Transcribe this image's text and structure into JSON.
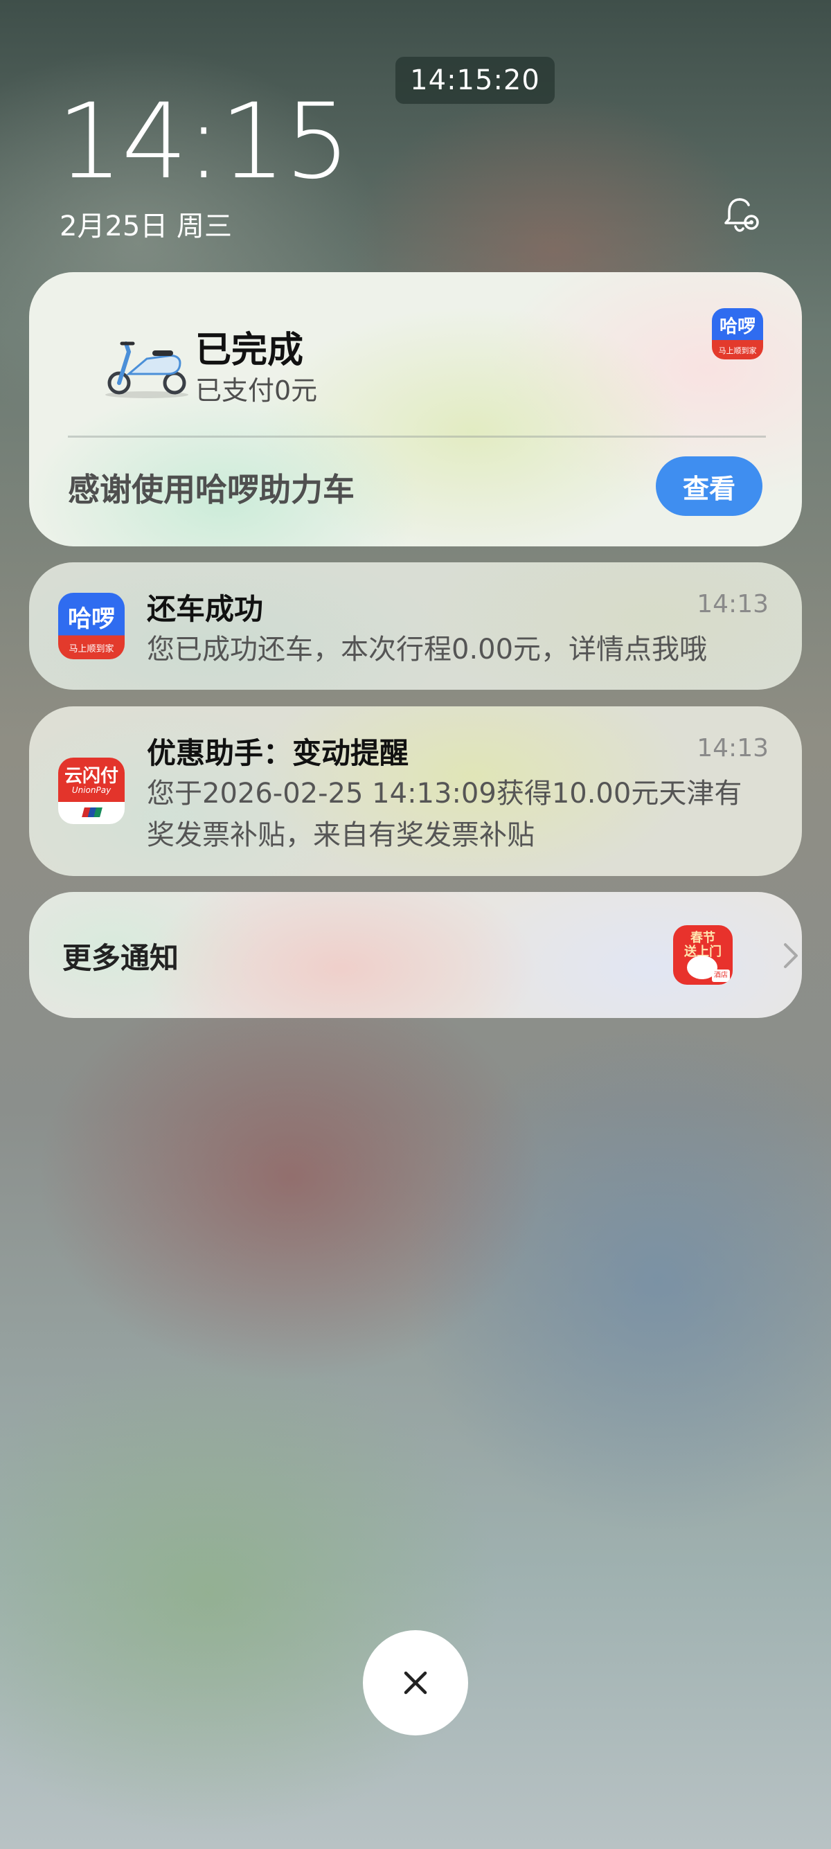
{
  "status": {
    "time_pill": "14:15:20"
  },
  "lockscreen": {
    "clock": "14:15",
    "date": "2月25日 周三"
  },
  "live_card": {
    "title": "已完成",
    "subtitle": "已支付0元",
    "app_icon_text": "哈啰",
    "app_icon_sub": "马上顺到家",
    "message": "感谢使用哈啰助力车",
    "view_button": "查看"
  },
  "notifications": [
    {
      "app_icon_text": "哈啰",
      "app_icon_sub": "马上顺到家",
      "title": "还车成功",
      "time": "14:13",
      "body": "您已成功还车，本次行程0.00元，详情点我哦"
    },
    {
      "app_icon_text": "云闪付",
      "app_icon_sub": "UnionPay",
      "title": "优惠助手：变动提醒",
      "time": "14:13",
      "body": "您于2026-02-25 14:13:09获得10.00元天津有奖发票补贴，来自有奖发票补贴"
    }
  ],
  "more": {
    "label": "更多通知",
    "icon_line1": "春节",
    "icon_line2": "送上门",
    "icon_tag": "酒店"
  },
  "icons": {
    "bell": "bell-settings-icon",
    "close": "close-icon",
    "chevron": "chevron-right-icon",
    "scooter": "scooter-icon"
  },
  "colors": {
    "accent_blue": "#3f8ef0",
    "hello_blue": "#2f6cf0",
    "unionpay_red": "#e3342b"
  }
}
